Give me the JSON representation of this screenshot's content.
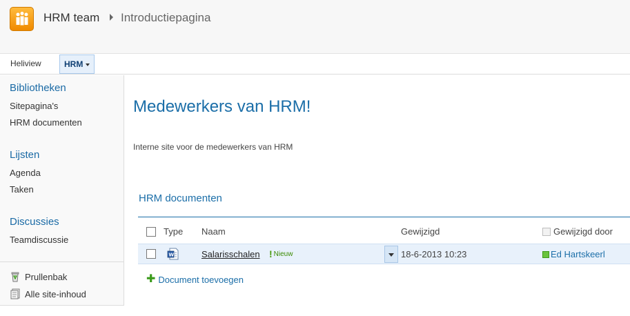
{
  "header": {
    "site_title": "HRM team",
    "page_title": "Introductiepagina"
  },
  "topnav": {
    "items": [
      {
        "label": "Heliview"
      },
      {
        "label": "HRM"
      }
    ]
  },
  "leftnav": {
    "sections": [
      {
        "heading": "Bibliotheken",
        "items": [
          "Sitepagina's",
          "HRM documenten"
        ]
      },
      {
        "heading": "Lijsten",
        "items": [
          "Agenda",
          "Taken"
        ]
      },
      {
        "heading": "Discussies",
        "items": [
          "Teamdiscussie"
        ]
      }
    ],
    "recycle_bin": "Prullenbak",
    "site_contents": "Alle site-inhoud"
  },
  "main": {
    "title": "Medewerkers van HRM!",
    "description": "Interne site voor de medewerkers van HRM"
  },
  "webpart": {
    "title": "HRM documenten",
    "columns": [
      "Type",
      "Naam",
      "Gewijzigd",
      "Gewijzigd door"
    ],
    "rows": [
      {
        "type_icon": "word-document-icon",
        "name": "Salarisschalen",
        "badge": "Nieuw",
        "modified": "18-6-2013 10:23",
        "modified_by": "Ed Hartskeerl"
      }
    ],
    "add_label": "Document toevoegen"
  },
  "colors": {
    "accent": "#1b6ea8",
    "logo": "#f59a0e",
    "new_badge": "#3a8a00",
    "presence": "#6ac33e"
  }
}
